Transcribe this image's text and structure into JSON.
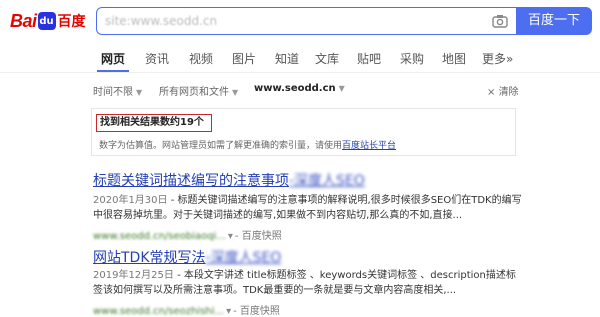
{
  "header": {
    "logo_left": "Bai",
    "logo_paw": "du",
    "logo_cn": "百度",
    "search_value": "site:www.seodd.cn",
    "search_button": "百度一下",
    "camera_icon": "camera-icon"
  },
  "tabs": [
    {
      "label": "网页",
      "active": true
    },
    {
      "label": "资讯"
    },
    {
      "label": "视频"
    },
    {
      "label": "图片"
    },
    {
      "label": "知道"
    },
    {
      "label": "文库"
    },
    {
      "label": "贴吧"
    },
    {
      "label": "采购"
    },
    {
      "label": "地图"
    },
    {
      "label": "更多»"
    }
  ],
  "filters": {
    "time": "时间不限",
    "scope": "所有网页和文件",
    "site": "www.seodd.cn",
    "clear": "清除"
  },
  "info": {
    "count": "找到相关结果数约19个",
    "hint_prefix": "数字为估算值。网站管理员如需了解更准确的索引量，请使用",
    "hint_link": "百度站长平台"
  },
  "results": [
    {
      "title_visible": "标题关键词描述编写的注意事项",
      "title_blurred": "-深度人SEO",
      "date": "2020年1月30日",
      "snippet": " - 标题关键词描述编写的注意事项的解释说明,很多时候很多SEO们在TDK的编写中很容易掉坑里。对于关键词描述的编写,如果做不到内容贴切,那么真的不如,直接...",
      "url_blurred": "www.seodd.cn/seobiaoqi...",
      "url_dd": "▾",
      "snapshot": "- 百度快照"
    },
    {
      "title_visible": "网站TDK常规写法",
      "title_blurred": "-深度人SEO",
      "date": "2019年12月25日",
      "snippet": " - 本段文字讲述 title标题标签 、keywords关键词标签 、description描述标签该如何撰写以及所需注意事项。TDK最重要的一条就是要与文章内容高度相关,...",
      "url_blurred": "www.seodd.cn/seozhishi...",
      "url_dd": "▾",
      "snapshot": "- 百度快照"
    }
  ],
  "colors": {
    "brand_blue": "#4e6ef2",
    "brand_red": "#e10602",
    "link": "#2440b3",
    "url_green": "#3d7a2a",
    "count_border": "#c62a2a"
  }
}
